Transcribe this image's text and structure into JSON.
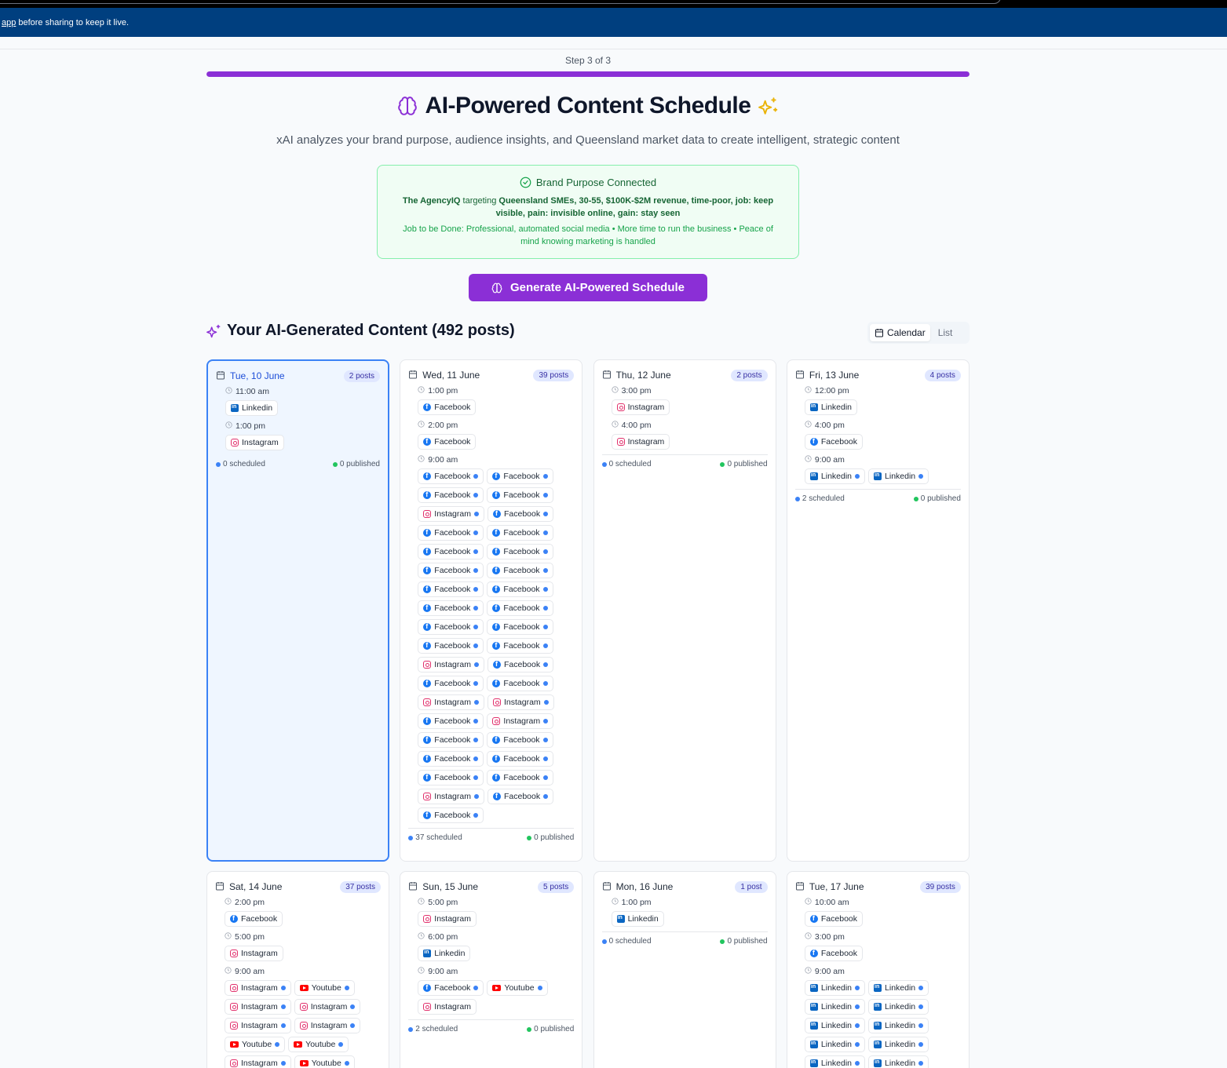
{
  "banner": {
    "link": "app",
    "text": "before sharing to keep it live."
  },
  "step": {
    "label": "Step 3 of 3",
    "progress": 1.0
  },
  "header": {
    "title": "AI-Powered Content Schedule",
    "subtitle": "xAI analyzes your brand purpose, audience insights, and Queensland market data to create intelligent, strategic content"
  },
  "brand": {
    "heading": "Brand Purpose Connected",
    "name": "The AgencyIQ",
    "targeting": "targeting",
    "audience": "Queensland SMEs, 30-55, $100K-$2M revenue, time-poor, job: keep visible, pain: invisible online, gain: stay seen",
    "jtbd": "Job to be Done: Professional, automated social media • More time to run the business • Peace of mind knowing marketing is handled"
  },
  "generate_label": "Generate AI-Powered Schedule",
  "section_title": "Your AI-Generated Content (492 posts)",
  "view_toggle": {
    "calendar": "Calendar",
    "list": "List"
  },
  "colors": {
    "accent": "#8b2fd6",
    "banner": "#003f7f",
    "selected": "#3b82f6"
  },
  "days": [
    {
      "date": "Tue, 10 June",
      "badge": "2 posts",
      "selected": true,
      "slots": [
        {
          "time": "11:00 am",
          "posts": [
            {
              "p": "Linkedin",
              "dot": false
            }
          ]
        },
        {
          "time": "1:00 pm",
          "posts": [
            {
              "p": "Instagram",
              "dot": false
            }
          ]
        }
      ],
      "scheduled": "0 scheduled",
      "published": "0 published"
    },
    {
      "date": "Wed, 11 June",
      "badge": "39 posts",
      "slots": [
        {
          "time": "1:00 pm",
          "posts": [
            {
              "p": "Facebook",
              "dot": false
            }
          ]
        },
        {
          "time": "2:00 pm",
          "posts": [
            {
              "p": "Facebook",
              "dot": false
            }
          ]
        },
        {
          "time": "9:00 am",
          "posts": [
            {
              "p": "Facebook",
              "dot": true
            },
            {
              "p": "Facebook",
              "dot": true
            },
            {
              "p": "Facebook",
              "dot": true
            },
            {
              "p": "Facebook",
              "dot": true
            },
            {
              "p": "Instagram",
              "dot": true
            },
            {
              "p": "Facebook",
              "dot": true
            },
            {
              "p": "Facebook",
              "dot": true
            },
            {
              "p": "Facebook",
              "dot": true
            },
            {
              "p": "Facebook",
              "dot": true
            },
            {
              "p": "Facebook",
              "dot": true
            },
            {
              "p": "Facebook",
              "dot": true
            },
            {
              "p": "Facebook",
              "dot": true
            },
            {
              "p": "Facebook",
              "dot": true
            },
            {
              "p": "Facebook",
              "dot": true
            },
            {
              "p": "Facebook",
              "dot": true
            },
            {
              "p": "Facebook",
              "dot": true
            },
            {
              "p": "Facebook",
              "dot": true
            },
            {
              "p": "Facebook",
              "dot": true
            },
            {
              "p": "Facebook",
              "dot": true
            },
            {
              "p": "Facebook",
              "dot": true
            },
            {
              "p": "Instagram",
              "dot": true
            },
            {
              "p": "Facebook",
              "dot": true
            },
            {
              "p": "Facebook",
              "dot": true
            },
            {
              "p": "Facebook",
              "dot": true
            },
            {
              "p": "Instagram",
              "dot": true
            },
            {
              "p": "Instagram",
              "dot": true
            },
            {
              "p": "Facebook",
              "dot": true
            },
            {
              "p": "Instagram",
              "dot": true
            },
            {
              "p": "Facebook",
              "dot": true
            },
            {
              "p": "Facebook",
              "dot": true
            },
            {
              "p": "Facebook",
              "dot": true
            },
            {
              "p": "Facebook",
              "dot": true
            },
            {
              "p": "Facebook",
              "dot": true
            },
            {
              "p": "Facebook",
              "dot": true
            },
            {
              "p": "Instagram",
              "dot": true
            },
            {
              "p": "Facebook",
              "dot": true
            },
            {
              "p": "Facebook",
              "dot": true
            }
          ]
        }
      ],
      "scheduled": "37 scheduled",
      "published": "0 published"
    },
    {
      "date": "Thu, 12 June",
      "badge": "2 posts",
      "slots": [
        {
          "time": "3:00 pm",
          "posts": [
            {
              "p": "Instagram",
              "dot": false
            }
          ]
        },
        {
          "time": "4:00 pm",
          "posts": [
            {
              "p": "Instagram",
              "dot": false
            }
          ]
        }
      ],
      "scheduled": "0 scheduled",
      "published": "0 published"
    },
    {
      "date": "Fri, 13 June",
      "badge": "4 posts",
      "slots": [
        {
          "time": "12:00 pm",
          "posts": [
            {
              "p": "Linkedin",
              "dot": false
            }
          ]
        },
        {
          "time": "4:00 pm",
          "posts": [
            {
              "p": "Facebook",
              "dot": false
            }
          ]
        },
        {
          "time": "9:00 am",
          "posts": [
            {
              "p": "Linkedin",
              "dot": true
            },
            {
              "p": "Linkedin",
              "dot": true
            }
          ]
        }
      ],
      "scheduled": "2 scheduled",
      "published": "0 published"
    },
    {
      "date": "Sat, 14 June",
      "badge": "37 posts",
      "slots": [
        {
          "time": "2:00 pm",
          "posts": [
            {
              "p": "Facebook",
              "dot": false
            }
          ]
        },
        {
          "time": "5:00 pm",
          "posts": [
            {
              "p": "Instagram",
              "dot": false
            }
          ]
        },
        {
          "time": "9:00 am",
          "posts": [
            {
              "p": "Instagram",
              "dot": true
            },
            {
              "p": "Youtube",
              "dot": true
            },
            {
              "p": "Instagram",
              "dot": true
            },
            {
              "p": "Instagram",
              "dot": true
            },
            {
              "p": "Instagram",
              "dot": true
            },
            {
              "p": "Instagram",
              "dot": true
            },
            {
              "p": "Youtube",
              "dot": true
            },
            {
              "p": "Youtube",
              "dot": true
            },
            {
              "p": "Instagram",
              "dot": true
            },
            {
              "p": "Youtube",
              "dot": true
            }
          ]
        }
      ],
      "scheduled": "",
      "published": ""
    },
    {
      "date": "Sun, 15 June",
      "badge": "5 posts",
      "slots": [
        {
          "time": "5:00 pm",
          "posts": [
            {
              "p": "Instagram",
              "dot": false
            }
          ]
        },
        {
          "time": "6:00 pm",
          "posts": [
            {
              "p": "Linkedin",
              "dot": false
            }
          ]
        },
        {
          "time": "9:00 am",
          "posts": [
            {
              "p": "Facebook",
              "dot": true
            },
            {
              "p": "Youtube",
              "dot": true
            },
            {
              "p": "Instagram",
              "dot": false
            }
          ]
        }
      ],
      "scheduled": "2 scheduled",
      "published": "0 published"
    },
    {
      "date": "Mon, 16 June",
      "badge": "1 post",
      "slots": [
        {
          "time": "1:00 pm",
          "posts": [
            {
              "p": "Linkedin",
              "dot": false
            }
          ]
        }
      ],
      "scheduled": "0 scheduled",
      "published": "0 published"
    },
    {
      "date": "Tue, 17 June",
      "badge": "39 posts",
      "slots": [
        {
          "time": "10:00 am",
          "posts": [
            {
              "p": "Facebook",
              "dot": false
            }
          ]
        },
        {
          "time": "3:00 pm",
          "posts": [
            {
              "p": "Facebook",
              "dot": false
            }
          ]
        },
        {
          "time": "9:00 am",
          "posts": [
            {
              "p": "Linkedin",
              "dot": true
            },
            {
              "p": "Linkedin",
              "dot": true
            },
            {
              "p": "Linkedin",
              "dot": true
            },
            {
              "p": "Linkedin",
              "dot": true
            },
            {
              "p": "Linkedin",
              "dot": true
            },
            {
              "p": "Linkedin",
              "dot": true
            },
            {
              "p": "Linkedin",
              "dot": true
            },
            {
              "p": "Linkedin",
              "dot": true
            },
            {
              "p": "Linkedin",
              "dot": true
            },
            {
              "p": "Linkedin",
              "dot": true
            }
          ]
        }
      ],
      "scheduled": "",
      "published": ""
    }
  ]
}
